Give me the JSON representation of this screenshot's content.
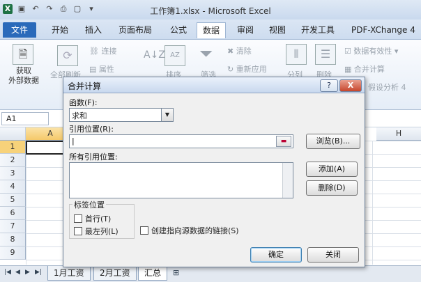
{
  "window": {
    "title": "工作簿1.xlsx - Microsoft Excel"
  },
  "ribbon_tabs": [
    "文件",
    "开始",
    "插入",
    "页面布局",
    "公式",
    "数据",
    "审阅",
    "视图",
    "开发工具",
    "PDF-XChange 4"
  ],
  "ribbon": {
    "get_external_data": "获取\n外部数据",
    "refresh_all": "全部刷新",
    "connections": "连接",
    "properties": "属性",
    "sort": "排序",
    "filter": "筛选",
    "clear": "清除",
    "reapply": "重新应用",
    "text_to_columns": "分列",
    "remove_duplicates": "删除",
    "data_validation": "数据有效性",
    "consolidate": "合并计算",
    "what_if": "假设分析",
    "what_if_num": "4"
  },
  "formula_bar": {
    "name_box": "A1"
  },
  "grid": {
    "columns": [
      "A",
      "H"
    ],
    "rows": [
      "1",
      "2",
      "3",
      "4",
      "5",
      "6",
      "7",
      "8",
      "9",
      "10",
      "11"
    ]
  },
  "sheets": [
    "1月工资",
    "2月工资",
    "汇总"
  ],
  "dialog": {
    "title": "合并计算",
    "function_label": "函数(F):",
    "function_value": "求和",
    "reference_label": "引用位置(R):",
    "reference_value": "|",
    "browse": "浏览(B)...",
    "all_references_label": "所有引用位置:",
    "add": "添加(A)",
    "delete": "删除(D)",
    "labels_group": "标签位置",
    "first_row": "首行(T)",
    "left_column": "最左列(L)",
    "create_links": "创建指向源数据的链接(S)",
    "ok": "确定",
    "close": "关闭",
    "help": "?",
    "x": "X"
  }
}
